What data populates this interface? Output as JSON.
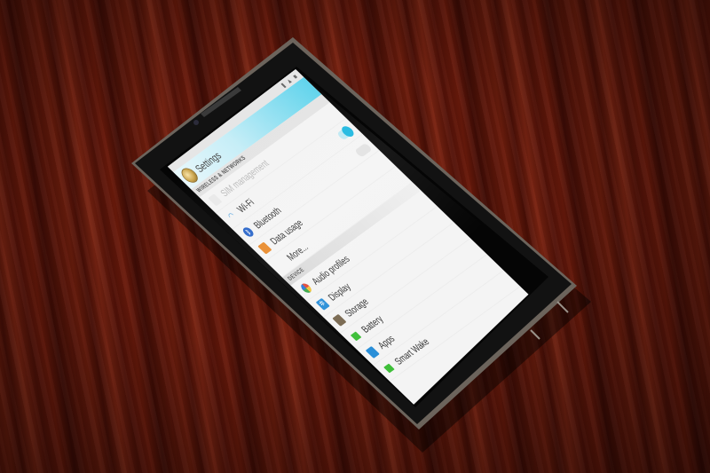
{
  "action_bar": {
    "title": "Settings"
  },
  "sections": {
    "wireless": "WIRELESS & NETWORKS",
    "device": "DEVICE"
  },
  "wireless_items": [
    {
      "label": "SIM management",
      "icon": "sim-card-icon"
    },
    {
      "label": "Wi-Fi",
      "icon": "wifi-icon"
    },
    {
      "label": "Bluetooth",
      "icon": "bluetooth-icon"
    },
    {
      "label": "Data usage",
      "icon": "data-usage-icon"
    },
    {
      "label": "More...",
      "icon": ""
    }
  ],
  "device_items": [
    {
      "label": "Audio profiles",
      "icon": "audio-profiles-icon"
    },
    {
      "label": "Display",
      "icon": "display-icon"
    },
    {
      "label": "Storage",
      "icon": "storage-icon"
    },
    {
      "label": "Battery",
      "icon": "battery-icon"
    },
    {
      "label": "Apps",
      "icon": "apps-icon"
    },
    {
      "label": "Smart Wake",
      "icon": "smart-wake-icon"
    }
  ],
  "colors": {
    "accent": "#1fb8e0",
    "wood": "#5a1509",
    "phone_body": "#141414"
  }
}
